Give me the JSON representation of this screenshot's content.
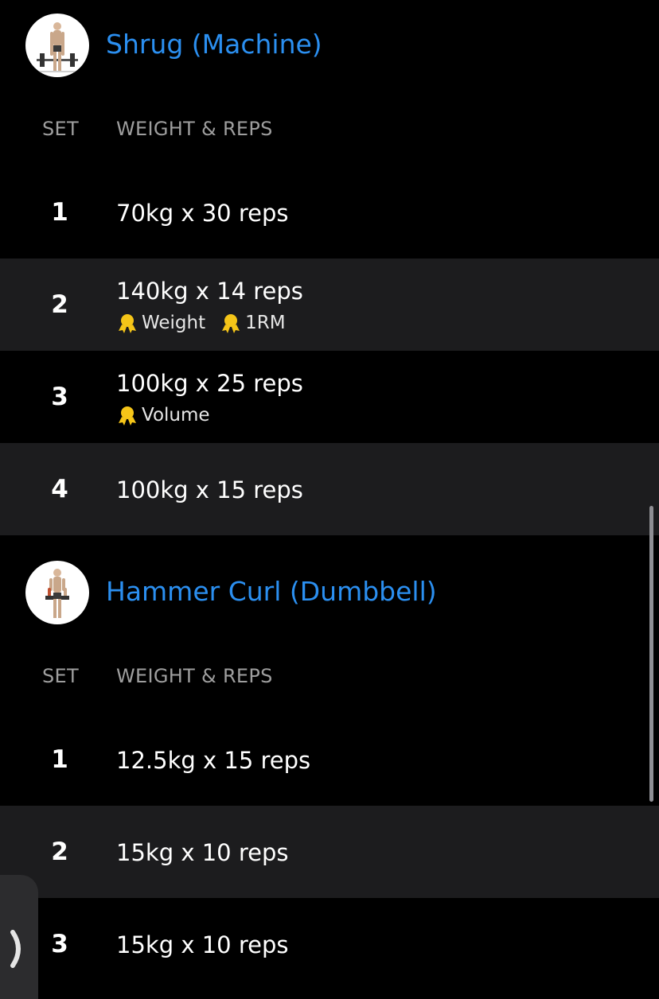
{
  "exercises": [
    {
      "title": "Shrug (Machine)",
      "columns": {
        "set": "SET",
        "weight_reps": "WEIGHT & REPS"
      },
      "sets": [
        {
          "num": "1",
          "value": "70kg x 30 reps",
          "prs": []
        },
        {
          "num": "2",
          "value": "140kg x 14 reps",
          "prs": [
            "Weight",
            "1RM"
          ]
        },
        {
          "num": "3",
          "value": "100kg x 25 reps",
          "prs": [
            "Volume"
          ]
        },
        {
          "num": "4",
          "value": "100kg x 15 reps",
          "prs": []
        }
      ]
    },
    {
      "title": "Hammer Curl (Dumbbell)",
      "columns": {
        "set": "SET",
        "weight_reps": "WEIGHT & REPS"
      },
      "sets": [
        {
          "num": "1",
          "value": "12.5kg x 15 reps",
          "prs": []
        },
        {
          "num": "2",
          "value": "15kg x 10 reps",
          "prs": []
        },
        {
          "num": "3",
          "value": "15kg x 10 reps",
          "prs": []
        }
      ]
    }
  ],
  "icons": {
    "pr_medal": "medal-icon",
    "side_tab": "chevron-right-icon"
  },
  "colors": {
    "background": "#000000",
    "row_alt": "#1c1c1e",
    "title_accent": "#2b8ff0",
    "column_header": "#9e9e9e",
    "medal": "#f5c518"
  }
}
